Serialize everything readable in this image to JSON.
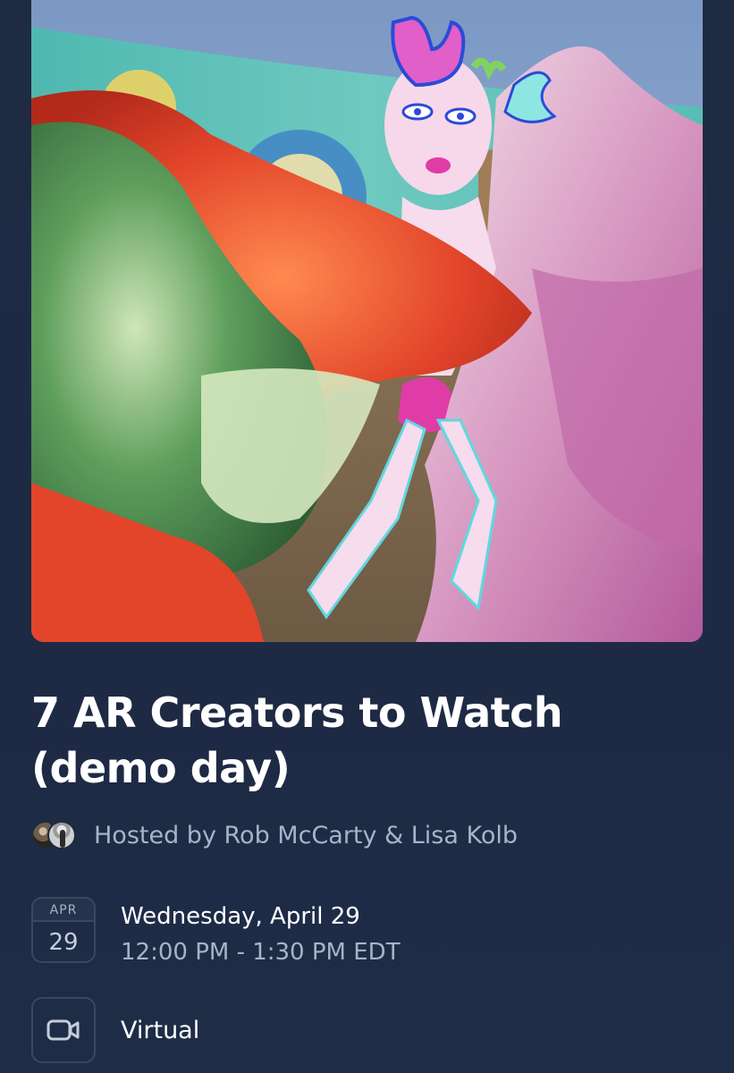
{
  "event": {
    "title_line1": "7 AR Creators to Watch",
    "title_line2": "(demo day)",
    "hosted_by": "Hosted by Rob McCarty & Lisa Kolb",
    "calendar": {
      "month": "APR",
      "day": "29"
    },
    "date_main": "Wednesday, April 29",
    "time_range": "12:00 PM - 1:30 PM EDT",
    "location": "Virtual"
  },
  "icons": {
    "location": "video-camera-icon"
  },
  "colors": {
    "background": "#1f2b44",
    "muted_text": "#a9b3c7",
    "border": "#3a4762"
  }
}
